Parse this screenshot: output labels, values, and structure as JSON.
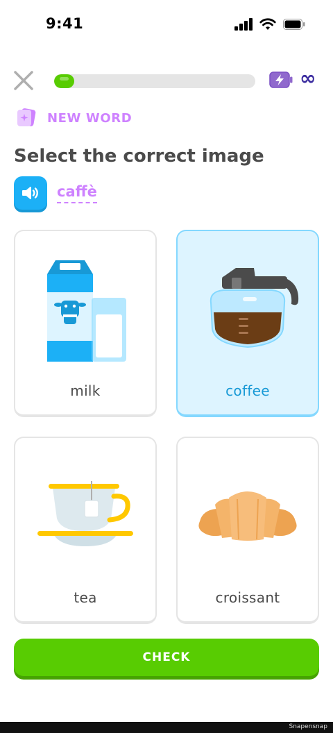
{
  "status_bar": {
    "time": "9:41",
    "icons": [
      "signal-icon",
      "wifi-icon",
      "battery-icon"
    ]
  },
  "header": {
    "close_icon": "close-icon",
    "progress": 0.1,
    "energy_icon": "energy-battery-icon",
    "energy_value": "∞"
  },
  "badge": {
    "icon": "new-word-card-icon",
    "label": "NEW WORD"
  },
  "prompt": {
    "title": "Select the correct image",
    "audio_icon": "speaker-icon",
    "word": "caffè"
  },
  "options": [
    {
      "label": "milk",
      "image": "milk-carton-and-glass",
      "selected": false
    },
    {
      "label": "coffee",
      "image": "coffee-pot",
      "selected": true
    },
    {
      "label": "tea",
      "image": "tea-cup-on-saucer",
      "selected": false
    },
    {
      "label": "croissant",
      "image": "croissant",
      "selected": false
    }
  ],
  "footer": {
    "check_label": "CHECK"
  },
  "watermark": "Snapensnap",
  "colors": {
    "accent_green": "#58cc02",
    "accent_purple": "#ce82ff",
    "accent_blue": "#1cb0f6",
    "selected_bg": "#ddf4ff",
    "selected_border": "#84d8ff"
  }
}
